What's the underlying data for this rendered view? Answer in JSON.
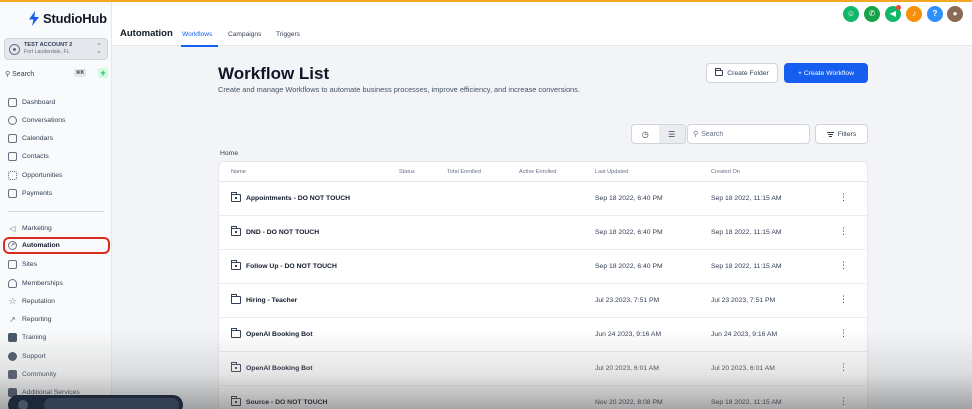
{
  "app": {
    "name": "StudioHub"
  },
  "account": {
    "name": "TEST ACCOUNT 2",
    "location": "Fort Lauderdale, FL"
  },
  "sidebar": {
    "search_label": "Search",
    "search_shortcut": "⌘K",
    "items": [
      {
        "label": "Dashboard",
        "icon": "dashboard-icon"
      },
      {
        "label": "Conversations",
        "icon": "chat-icon"
      },
      {
        "label": "Calendars",
        "icon": "calendar-icon"
      },
      {
        "label": "Contacts",
        "icon": "contacts-icon"
      },
      {
        "label": "Opportunities",
        "icon": "opportunities-icon"
      },
      {
        "label": "Payments",
        "icon": "payments-icon"
      },
      {
        "label": "Marketing",
        "icon": "send-icon"
      },
      {
        "label": "Automation",
        "icon": "automation-icon"
      },
      {
        "label": "Sites",
        "icon": "sites-icon"
      },
      {
        "label": "Memberships",
        "icon": "memberships-icon"
      },
      {
        "label": "Reputation",
        "icon": "star-icon"
      },
      {
        "label": "Reporting",
        "icon": "chart-line-icon"
      },
      {
        "label": "Training",
        "icon": "book-icon"
      },
      {
        "label": "Support",
        "icon": "support-icon"
      },
      {
        "label": "Community",
        "icon": "community-icon"
      },
      {
        "label": "Additional Services",
        "icon": "services-icon"
      }
    ]
  },
  "header": {
    "title": "Automation",
    "tabs": [
      "Workflows",
      "Campaigns",
      "Triggers"
    ],
    "active_tab": "Workflows"
  },
  "page": {
    "title": "Workflow List",
    "description": "Create and manage Workflows to automate business processes, improve efficiency, and increase conversions.",
    "create_folder_label": "Create Folder",
    "create_workflow_label": "+ Create Workflow",
    "search_placeholder": "Search",
    "filters_label": "Filters",
    "breadcrumb": "Home"
  },
  "table": {
    "columns": [
      "Name",
      "Status",
      "Total Enrolled",
      "Active Enrolled",
      "Last Updated",
      "Created On"
    ],
    "rows": [
      {
        "name": "Appointments - DO NOT TOUCH",
        "locked": true,
        "updated": "Sep 18 2022, 6:40 PM",
        "created": "Sep 18 2022, 11:15 AM"
      },
      {
        "name": "DND - DO NOT TOUCH",
        "locked": true,
        "updated": "Sep 18 2022, 6:40 PM",
        "created": "Sep 18 2022, 11:15 AM"
      },
      {
        "name": "Follow Up - DO NOT TOUCH",
        "locked": true,
        "updated": "Sep 18 2022, 6:40 PM",
        "created": "Sep 18 2022, 11:15 AM"
      },
      {
        "name": "Hiring - Teacher",
        "locked": false,
        "updated": "Jul 23 2023, 7:51 PM",
        "created": "Jul 23 2023, 7:51 PM"
      },
      {
        "name": "OpenAI Booking Bot",
        "locked": false,
        "updated": "Jun 24 2023, 9:16 AM",
        "created": "Jun 24 2023, 9:16 AM"
      },
      {
        "name": "OpenAI Booking Bot",
        "locked": true,
        "updated": "Jul 20 2023, 6:01 AM",
        "created": "Jul 20 2023, 6:01 AM"
      },
      {
        "name": "Source - DO NOT TOUCH",
        "locked": true,
        "updated": "Nov 20 2022, 8:08 PM",
        "created": "Sep 18 2022, 11:15 AM"
      }
    ]
  },
  "colors": {
    "primary": "#155eef",
    "active_outline": "#d92d20",
    "accent_stripe": "#f5a623"
  }
}
